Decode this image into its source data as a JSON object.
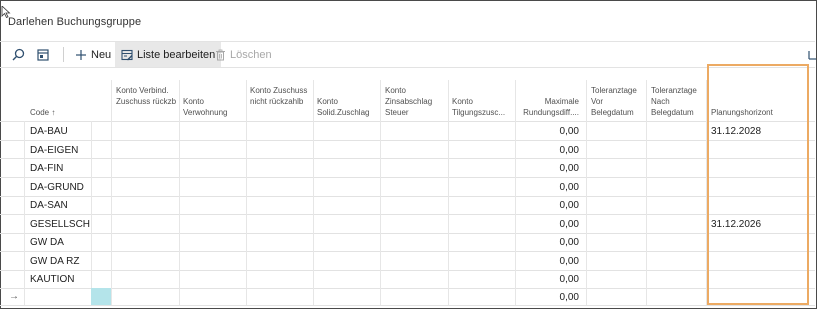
{
  "page": {
    "title": "Darlehen Buchungsgruppe"
  },
  "toolbar": {
    "new_label": "Neu",
    "edit_list_label": "Liste bearbeiten",
    "delete_label": "Löschen"
  },
  "columns": [
    "Code ↑",
    "Konto Verbind. Zuschuss rückzb",
    "Konto Verwohnung",
    "Konto Zuschuss nicht rückzahlb",
    "Konto Solid.Zuschlag",
    "Konto Zinsabschlag Steuer",
    "Konto Tilgungszusc...",
    "Maximale Rundungsdiff....",
    "Toleranztage Vor Belegdatum",
    "Toleranztage Nach Belegdatum",
    "Planungshorizont"
  ],
  "rows": [
    {
      "code": "DA-BAU",
      "max_rund": "0,00",
      "plan": "31.12.2028"
    },
    {
      "code": "DA-EIGEN",
      "max_rund": "0,00",
      "plan": ""
    },
    {
      "code": "DA-FIN",
      "max_rund": "0,00",
      "plan": ""
    },
    {
      "code": "DA-GRUND",
      "max_rund": "0,00",
      "plan": ""
    },
    {
      "code": "DA-SAN",
      "max_rund": "0,00",
      "plan": ""
    },
    {
      "code": "GESELLSCH",
      "max_rund": "0,00",
      "plan": "31.12.2026"
    },
    {
      "code": "GW DA",
      "max_rund": "0,00",
      "plan": ""
    },
    {
      "code": "GW DA RZ",
      "max_rund": "0,00",
      "plan": ""
    },
    {
      "code": "KAUTION",
      "max_rund": "0,00",
      "plan": ""
    },
    {
      "code": "",
      "max_rund": "0,00",
      "plan": ""
    }
  ],
  "new_row_indicator": "→",
  "colors": {
    "highlight": "#ecaa63",
    "selected_cell": "#b4e4ea",
    "edit_icon": "#2f4f6f"
  }
}
